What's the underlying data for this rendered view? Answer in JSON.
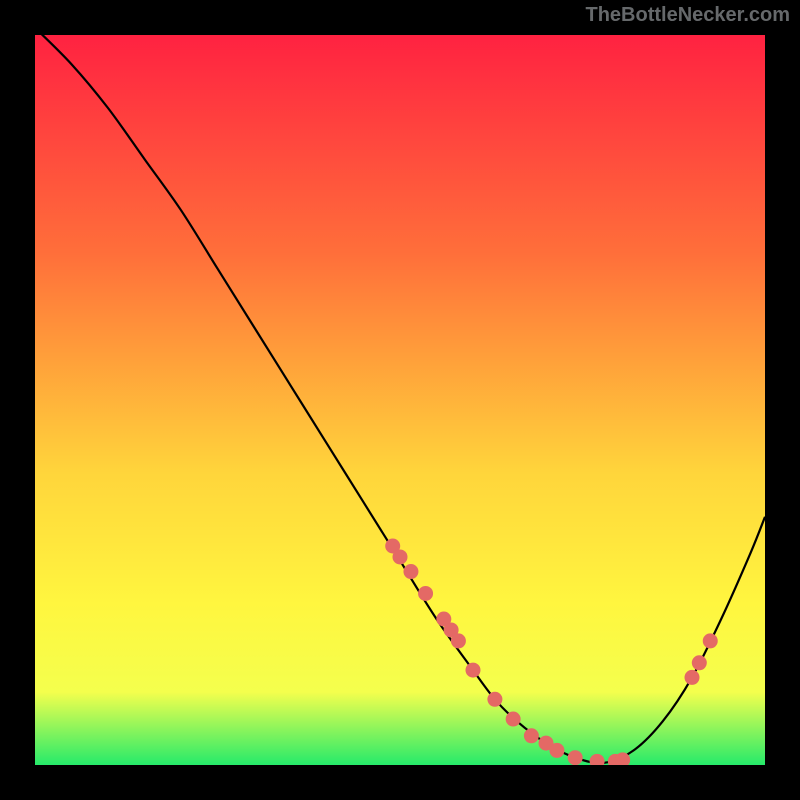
{
  "attribution": "TheBottleNecker.com",
  "colors": {
    "background": "#000000",
    "gradient_top": "#ff2241",
    "gradient_mid1": "#ff6f3a",
    "gradient_mid2": "#ffd53b",
    "gradient_mid3": "#fff63f",
    "gradient_mid4": "#f4ff4d",
    "gradient_bottom": "#26ea6a",
    "curve": "#000000",
    "marker": "#e46965"
  },
  "chart_data": {
    "type": "line",
    "title": "",
    "xlabel": "",
    "ylabel": "",
    "xlim": [
      0,
      100
    ],
    "ylim": [
      0,
      100
    ],
    "series": [
      {
        "name": "bottleneck-curve",
        "x": [
          0,
          5,
          10,
          15,
          20,
          25,
          30,
          35,
          40,
          45,
          50,
          55,
          60,
          63,
          66,
          70,
          74,
          78,
          82,
          86,
          90,
          94,
          98,
          100
        ],
        "y": [
          101,
          96,
          90,
          83,
          76,
          68,
          60,
          52,
          44,
          36,
          28,
          20,
          13,
          9,
          6,
          3,
          1,
          0.3,
          2,
          6,
          12,
          20,
          29,
          34
        ]
      }
    ],
    "markers": {
      "name": "highlighted-points",
      "x": [
        49,
        50,
        51.5,
        53.5,
        56,
        57,
        58,
        60,
        63,
        65.5,
        68,
        70,
        71.5,
        74,
        77,
        79.5,
        80.5,
        90,
        91,
        92.5
      ],
      "y": [
        30,
        28.5,
        26.5,
        23.5,
        20,
        18.5,
        17,
        13,
        9,
        6.3,
        4,
        3,
        2,
        1,
        0.5,
        0.5,
        0.7,
        12,
        14,
        17
      ]
    }
  }
}
